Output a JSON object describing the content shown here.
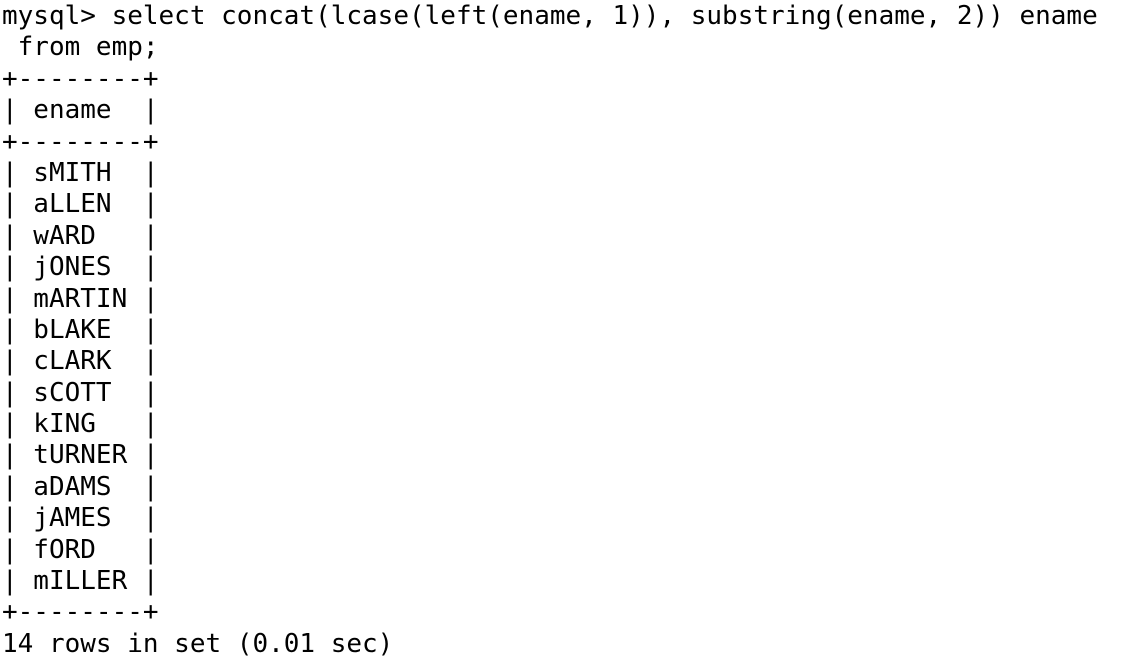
{
  "terminal": {
    "name": "mysql-client-terminal",
    "background_color": "#ffffff",
    "text_color": "#000000",
    "prompt": "mysql>",
    "query": {
      "line_1": "mysql> select concat(lcase(left(ename, 1)), substring(ename, 2)) ename",
      "line_2": " from emp;"
    },
    "result_table": {
      "border": "+--------+",
      "header_row": "| ename  |",
      "column_header": "ename",
      "rows": [
        "| sMITH  |",
        "| aLLEN  |",
        "| wARD   |",
        "| jONES  |",
        "| mARTIN |",
        "| bLAKE  |",
        "| cLARK  |",
        "| sCOTT  |",
        "| kING   |",
        "| tURNER |",
        "| aDAMS  |",
        "| jAMES  |",
        "| fORD   |",
        "| mILLER |"
      ],
      "values": [
        "sMITH",
        "aLLEN",
        "wARD",
        "jONES",
        "mARTIN",
        "bLAKE",
        "cLARK",
        "sCOTT",
        "kING",
        "tURNER",
        "aDAMS",
        "jAMES",
        "fORD",
        "mILLER"
      ]
    },
    "status": "14 rows in set (0.01 sec)",
    "row_count": 14,
    "elapsed": "0.01 sec",
    "lines": [
      "mysql> select concat(lcase(left(ename, 1)), substring(ename, 2)) ename",
      " from emp;",
      "+--------+",
      "| ename  |",
      "+--------+",
      "| sMITH  |",
      "| aLLEN  |",
      "| wARD   |",
      "| jONES  |",
      "| mARTIN |",
      "| bLAKE  |",
      "| cLARK  |",
      "| sCOTT  |",
      "| kING   |",
      "| tURNER |",
      "| aDAMS  |",
      "| jAMES  |",
      "| fORD   |",
      "| mILLER |",
      "+--------+",
      "14 rows in set (0.01 sec)"
    ]
  }
}
